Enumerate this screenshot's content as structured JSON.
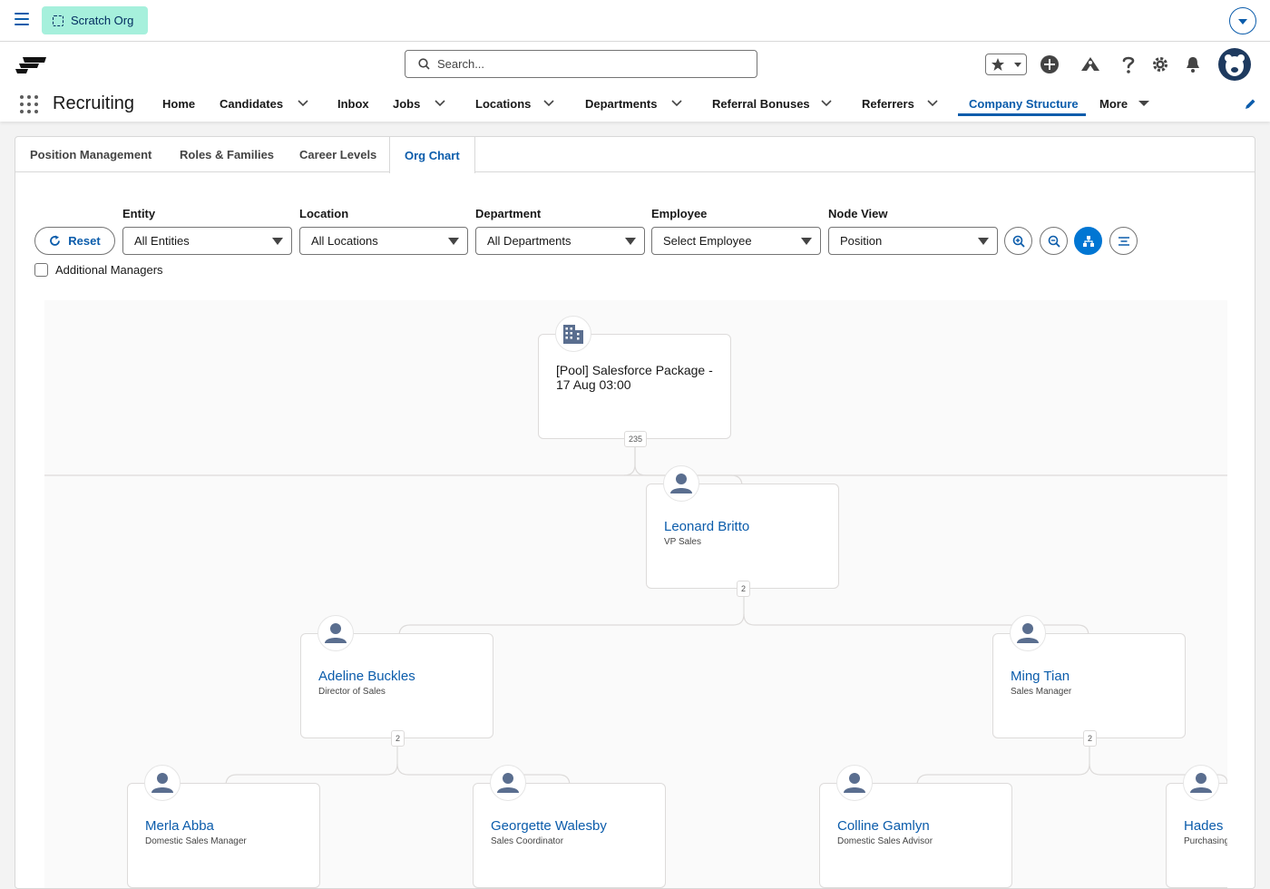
{
  "topbar": {
    "org_label": "Scratch Org"
  },
  "header": {
    "search_placeholder": "Search...",
    "app_name": "Recruiting",
    "nav": [
      {
        "label": "Home"
      },
      {
        "label": "Candidates"
      },
      {
        "label": "Inbox"
      },
      {
        "label": "Jobs"
      },
      {
        "label": "Locations"
      },
      {
        "label": "Departments"
      },
      {
        "label": "Referral Bonuses"
      },
      {
        "label": "Referrers"
      },
      {
        "label": "Company Structure"
      },
      {
        "label": "More"
      }
    ],
    "active_nav": "Company Structure",
    "accent_color": "#0b5cab"
  },
  "tabs": [
    {
      "label": "Position Management"
    },
    {
      "label": "Roles & Families"
    },
    {
      "label": "Career Levels"
    },
    {
      "label": "Org Chart"
    }
  ],
  "filters": {
    "reset_label": "Reset",
    "entity": {
      "label": "Entity",
      "value": "All Entities"
    },
    "location": {
      "label": "Location",
      "value": "All Locations"
    },
    "department": {
      "label": "Department",
      "value": "All Departments"
    },
    "employee": {
      "label": "Employee",
      "value": "Select Employee"
    },
    "node_view": {
      "label": "Node View",
      "value": "Position"
    },
    "additional_managers_label": "Additional Managers"
  },
  "org_chart": {
    "root": {
      "name": "[Pool] Salesforce Package - 17 Aug 03:00",
      "count": "235"
    },
    "level1": {
      "name": "Leonard Britto",
      "title": "VP Sales",
      "count": "2"
    },
    "level2": [
      {
        "name": "Adeline Buckles",
        "title": "Director of Sales",
        "count": "2"
      },
      {
        "name": "Ming Tian",
        "title": "Sales Manager",
        "count": "2"
      }
    ],
    "level3": [
      {
        "name": "Merla Abba",
        "title": "Domestic Sales Manager"
      },
      {
        "name": "Georgette Walesby",
        "title": "Sales Coordinator"
      },
      {
        "name": "Colline Gamlyn",
        "title": "Domestic Sales Advisor"
      },
      {
        "name": "Hades",
        "title": "Purchasing"
      }
    ]
  }
}
